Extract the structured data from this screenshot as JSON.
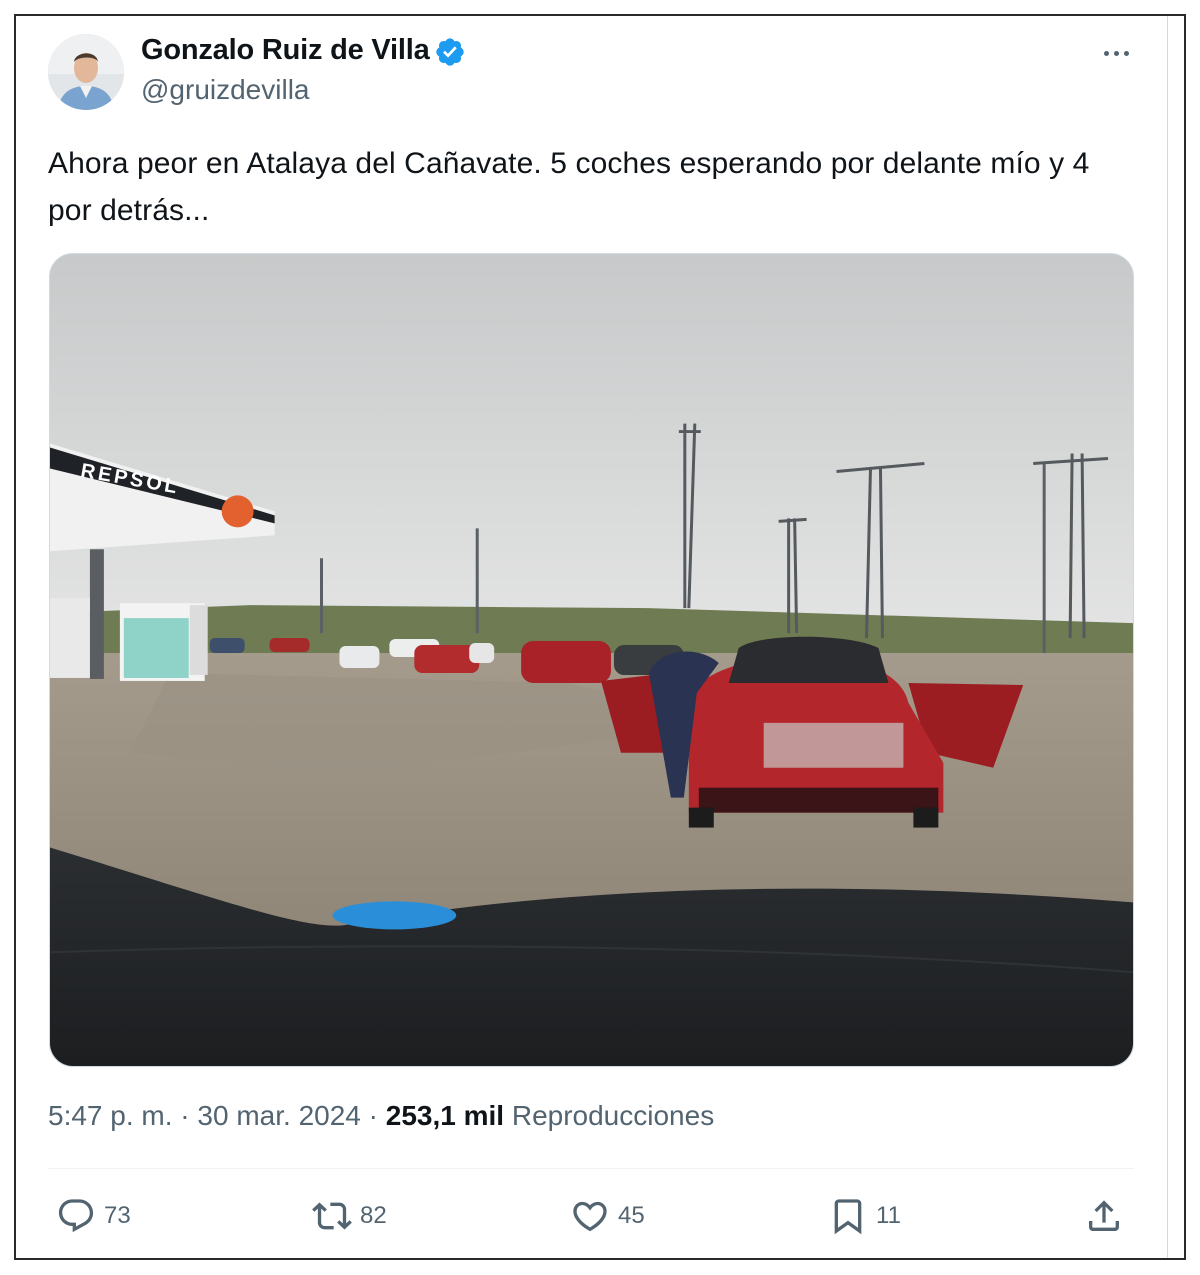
{
  "author": {
    "name": "Gonzalo Ruiz de Villa",
    "handle": "@gruizdevilla",
    "verified": true,
    "verified_color": "#1d9bf0"
  },
  "tweet": {
    "text": "Ahora peor en Atalaya del Cañavate. 5 coches esperando por delante mío y 4 por detrás...",
    "media_sign_text": "REPSOL"
  },
  "meta": {
    "time": "5:47 p. m.",
    "separator": "·",
    "date": "30 mar. 2024",
    "views_count": "253,1 mil",
    "views_label": "Reproducciones"
  },
  "actions": {
    "reply": {
      "icon": "reply-icon",
      "count": "73"
    },
    "retweet": {
      "icon": "retweet-icon",
      "count": "82"
    },
    "like": {
      "icon": "heart-icon",
      "count": "45"
    },
    "bookmark": {
      "icon": "bookmark-icon",
      "count": "11"
    },
    "share": {
      "icon": "share-icon"
    }
  },
  "colors": {
    "text_primary": "#0f1419",
    "text_secondary": "#536471",
    "accent": "#1d9bf0"
  }
}
